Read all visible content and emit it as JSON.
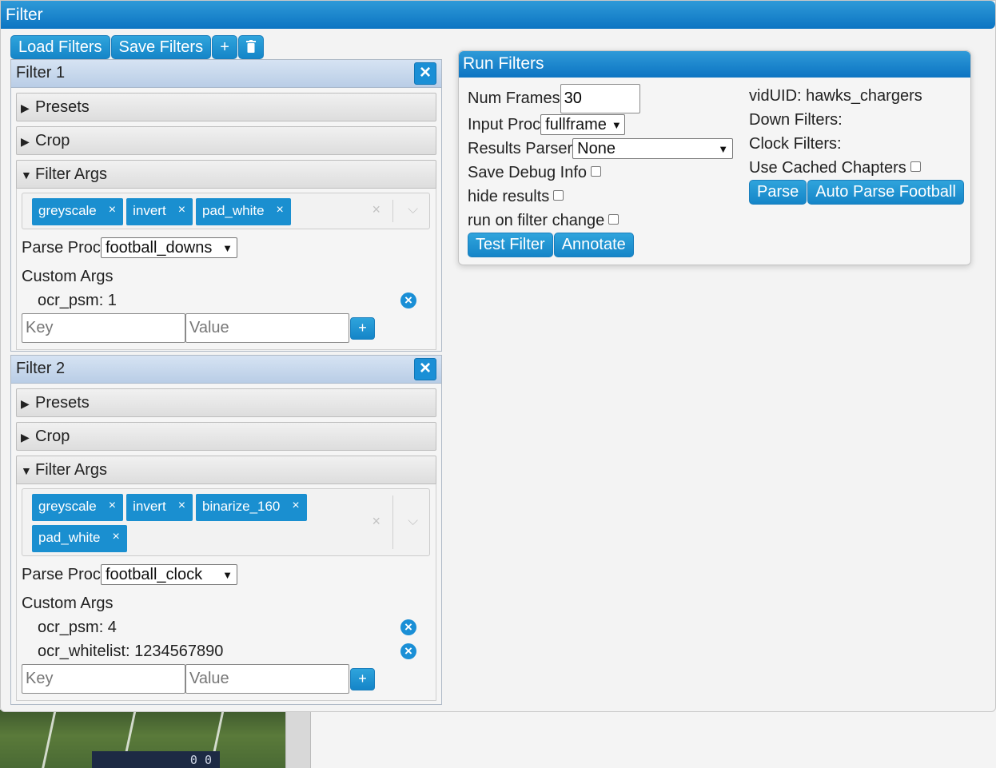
{
  "window": {
    "title": "Filter"
  },
  "toolbar": {
    "load_label": "Load Filters",
    "save_label": "Save Filters",
    "add_label": "+",
    "delete_icon": "trash-icon"
  },
  "filters": [
    {
      "title": "Filter 1",
      "sections": {
        "presets": "Presets",
        "crop": "Crop",
        "filter_args": "Filter Args"
      },
      "chips": [
        "greyscale",
        "invert",
        "pad_white"
      ],
      "parse_proc_label": "Parse Proc",
      "parse_proc_value": "football_downs",
      "custom_args_label": "Custom Args",
      "custom_args": [
        "ocr_psm: 1"
      ],
      "key_placeholder": "Key",
      "value_placeholder": "Value"
    },
    {
      "title": "Filter 2",
      "sections": {
        "presets": "Presets",
        "crop": "Crop",
        "filter_args": "Filter Args"
      },
      "chips": [
        "greyscale",
        "invert",
        "binarize_160",
        "pad_white"
      ],
      "parse_proc_label": "Parse Proc",
      "parse_proc_value": "football_clock",
      "custom_args_label": "Custom Args",
      "custom_args": [
        "ocr_psm: 4",
        "ocr_whitelist: 1234567890"
      ],
      "key_placeholder": "Key",
      "value_placeholder": "Value"
    }
  ],
  "run_filters": {
    "title": "Run Filters",
    "num_frames_label": "Num Frames",
    "num_frames_value": "30",
    "input_proc_label": "Input Proc",
    "input_proc_value": "fullframe",
    "results_parser_label": "Results Parser",
    "results_parser_value": "None",
    "save_debug_label": "Save Debug Info",
    "hide_results_label": "hide results",
    "run_on_change_label": "run on filter change",
    "test_filter_label": "Test Filter",
    "annotate_label": "Annotate",
    "vid_uid": "vidUID: hawks_chargers",
    "down_filters": "Down Filters:",
    "clock_filters": "Clock Filters:",
    "use_cached_label": "Use Cached Chapters",
    "parse_label": "Parse",
    "auto_parse_label": "Auto Parse Football"
  },
  "scorebug": {
    "score": "0 0"
  },
  "icons": {
    "remove": "close-icon",
    "chip_remove": "×",
    "clear": "×",
    "caret": "chevron-down-icon"
  },
  "colors": {
    "accent": "#1a8fd6",
    "titlebar": "#0c74c2",
    "filter_header": "#c7d8ee"
  }
}
